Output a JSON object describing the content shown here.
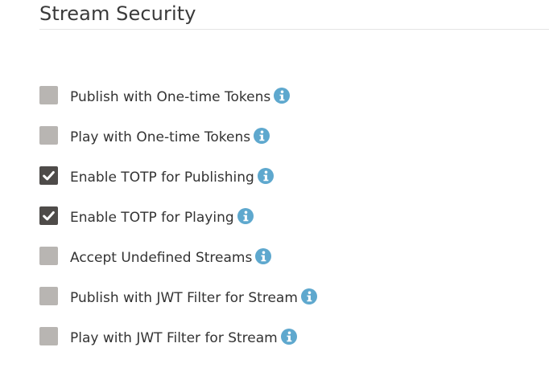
{
  "section": {
    "title": "Stream Security"
  },
  "colors": {
    "checkbox_unchecked": "#b8b5b2",
    "checkbox_checked": "#4e4b49",
    "info_icon": "#5ea8ce",
    "text": "#333333"
  },
  "options": [
    {
      "label": "Publish with One-time Tokens",
      "checked": false,
      "icon": "info-icon"
    },
    {
      "label": "Play with One-time Tokens",
      "checked": false,
      "icon": "info-icon"
    },
    {
      "label": "Enable TOTP for Publishing",
      "checked": true,
      "icon": "info-icon"
    },
    {
      "label": "Enable TOTP for Playing",
      "checked": true,
      "icon": "info-icon"
    },
    {
      "label": "Accept Undefined Streams",
      "checked": false,
      "icon": "info-icon"
    },
    {
      "label": "Publish with JWT Filter for Stream",
      "checked": false,
      "icon": "info-icon"
    },
    {
      "label": "Play with JWT Filter for Stream",
      "checked": false,
      "icon": "info-icon"
    }
  ]
}
